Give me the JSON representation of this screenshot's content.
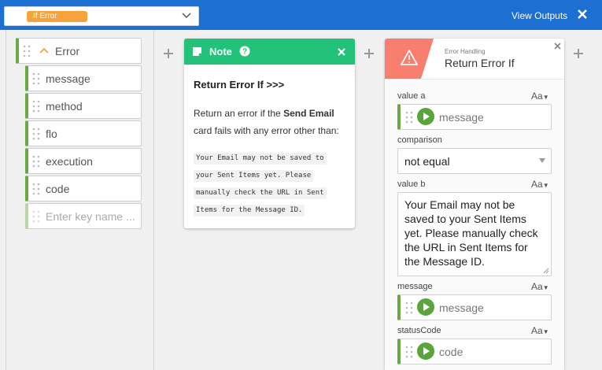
{
  "topbar": {
    "selected_tag": "If Error",
    "view_outputs": "View Outputs",
    "accent": "#1e6fd2",
    "tag_color": "#f6a33c"
  },
  "tree": {
    "root": "Error",
    "children": [
      "message",
      "method",
      "flo",
      "execution",
      "code"
    ],
    "new_key_placeholder": "Enter key name ..."
  },
  "note": {
    "title": "Note",
    "heading": "Return Error If >>>",
    "body_prefix": "Return an error if the ",
    "body_bold": "Send Email",
    "body_suffix": " card fails with any error other than:",
    "code_lines": [
      "Your Email may not be saved to",
      "your Sent Items yet. Please",
      "manually check the URL in Sent",
      "Items for the Message ID."
    ],
    "color": "#23c17a"
  },
  "error_card": {
    "category": "Error Handling",
    "title": "Return Error If",
    "icon_color": "#f87e6f",
    "type_toggle": "Aa",
    "fields": {
      "value_a": {
        "label": "value a",
        "value": "message"
      },
      "comparison": {
        "label": "comparison",
        "value": "not equal"
      },
      "value_b": {
        "label": "value b",
        "value": "Your Email may not be saved to your Sent Items yet. Please manually check the URL in Sent Items for the Message ID."
      },
      "message": {
        "label": "message",
        "value": "message"
      },
      "status_code": {
        "label": "statusCode",
        "value": "code"
      }
    }
  }
}
